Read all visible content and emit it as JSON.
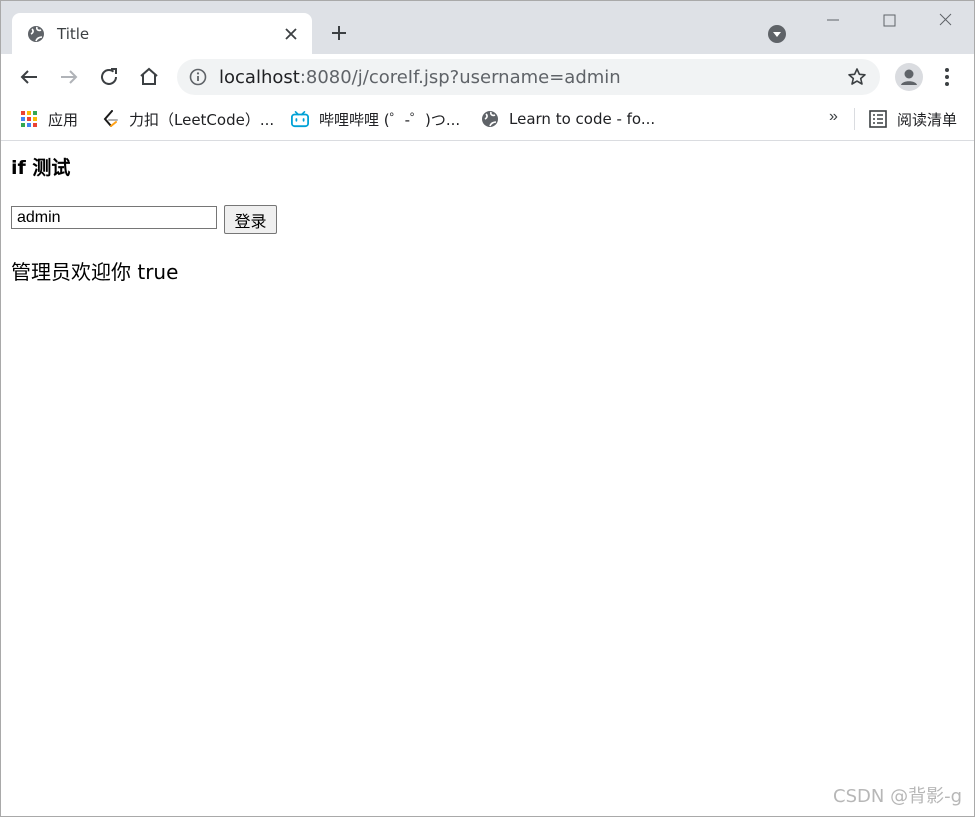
{
  "browser": {
    "tab": {
      "title": "Title",
      "favicon": "globe-icon"
    },
    "address_bar": {
      "url_host": "localhost",
      "url_rest": ":8080/j/coreIf.jsp?username=admin"
    },
    "bookmarks": [
      {
        "label": "应用",
        "icon": "apps-grid-icon"
      },
      {
        "label": "力扣（LeetCode）...",
        "icon": "leetcode-icon"
      },
      {
        "label": "哔哩哔哩 (゜-゜)つ...",
        "icon": "bilibili-icon"
      },
      {
        "label": "Learn to code - fo...",
        "icon": "globe-icon"
      }
    ],
    "bookmarks_overflow": "»",
    "reading_list_label": "阅读清单"
  },
  "page": {
    "heading": "if 测试",
    "form": {
      "username_value": "admin",
      "submit_label": "登录"
    },
    "welcome_text": "管理员欢迎你 true"
  },
  "watermark": "CSDN @背影-g"
}
